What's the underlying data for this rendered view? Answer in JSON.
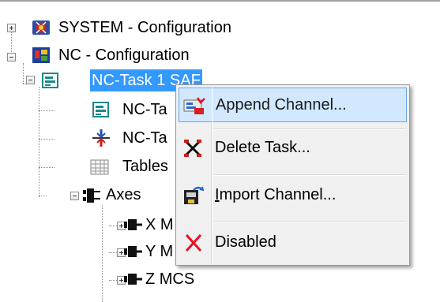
{
  "tree": {
    "system_configuration": "SYSTEM - Configuration",
    "nc_configuration": "NC - Configuration",
    "nc_task": "NC-Task 1 SAF",
    "nc_task_sub1": "NC-Ta",
    "nc_task_sub2": "NC-Ta",
    "tables": "Tables",
    "axes": "Axes",
    "axis_x": "X M",
    "axis_y": "Y M",
    "axis_z": "Z MCS"
  },
  "context_menu": {
    "append_channel": {
      "label": "Append Channel...",
      "icon": "append-channel-icon"
    },
    "delete_task": {
      "label": "Delete Task...",
      "icon": "delete-task-icon"
    },
    "import_channel": {
      "label_prefix": "",
      "label_accel": "I",
      "label_rest": "mport Channel...",
      "icon": "import-channel-icon"
    },
    "disabled": {
      "label": "Disabled",
      "icon": "disabled-x-icon"
    }
  },
  "colors": {
    "selection": "#3399ff",
    "menu_background": "#f0f0f0",
    "menu_highlight": "#d1e8ff",
    "menu_highlight_border": "#66a7e8",
    "disabled_x": "#e81123"
  }
}
